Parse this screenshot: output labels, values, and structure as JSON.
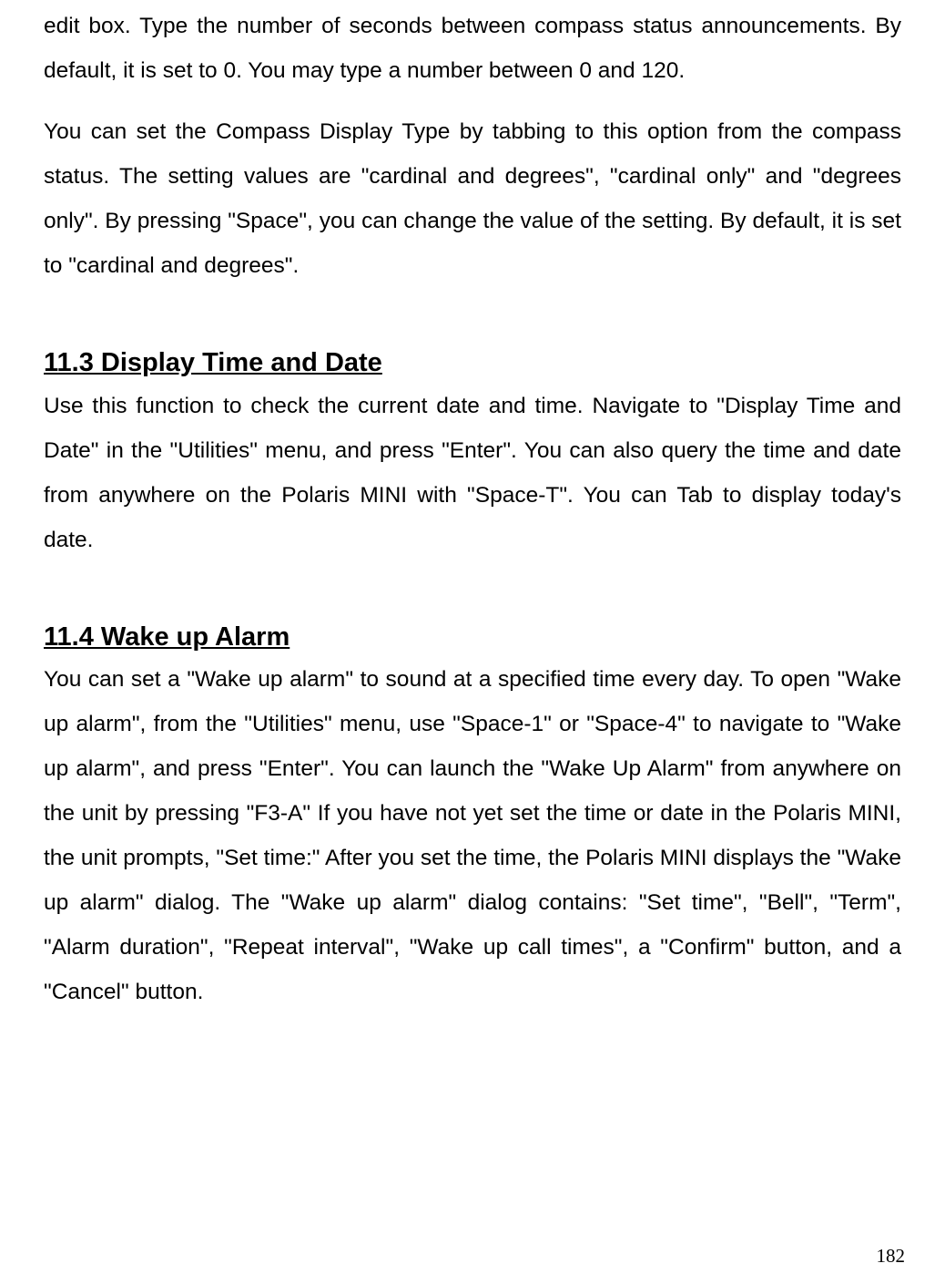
{
  "paragraphs": {
    "p1": "edit box. Type the number of seconds between compass status announcements. By default, it is set to 0. You may type a number between 0 and 120.",
    "p2": "You can set the Compass Display Type by tabbing to this option from the compass status. The setting values are \"cardinal and degrees\", \"cardinal only\" and \"degrees only\". By pressing \"Space\", you can change the value of the setting. By default, it is set to \"cardinal and degrees\"."
  },
  "section1": {
    "heading": "11.3 Display Time and Date",
    "body": "Use this function to check the current date and time. Navigate to \"Display Time and Date\" in the \"Utilities\" menu, and press \"Enter\". You can also query the time and date from anywhere on the Polaris MINI with \"Space-T\". You can Tab to display today's date."
  },
  "section2": {
    "heading": "11.4 Wake up Alarm",
    "body": "You can set a \"Wake up alarm\" to sound at a specified time every day. To open \"Wake up alarm\", from the \"Utilities\" menu, use \"Space-1\" or \"Space-4\" to navigate to \"Wake up alarm\", and press \"Enter\". You can launch the \"Wake Up Alarm\" from anywhere on the unit by pressing \"F3-A\" If you have not yet set the time or date in the Polaris MINI, the unit prompts, \"Set time:\" After you set the time, the Polaris MINI displays the \"Wake up alarm\" dialog. The \"Wake up alarm\" dialog contains: \"Set time\", \"Bell\", \"Term\", \"Alarm duration\", \"Repeat interval\", \"Wake up call times\", a \"Confirm\" button, and a \"Cancel\" button."
  },
  "page_number": "182"
}
